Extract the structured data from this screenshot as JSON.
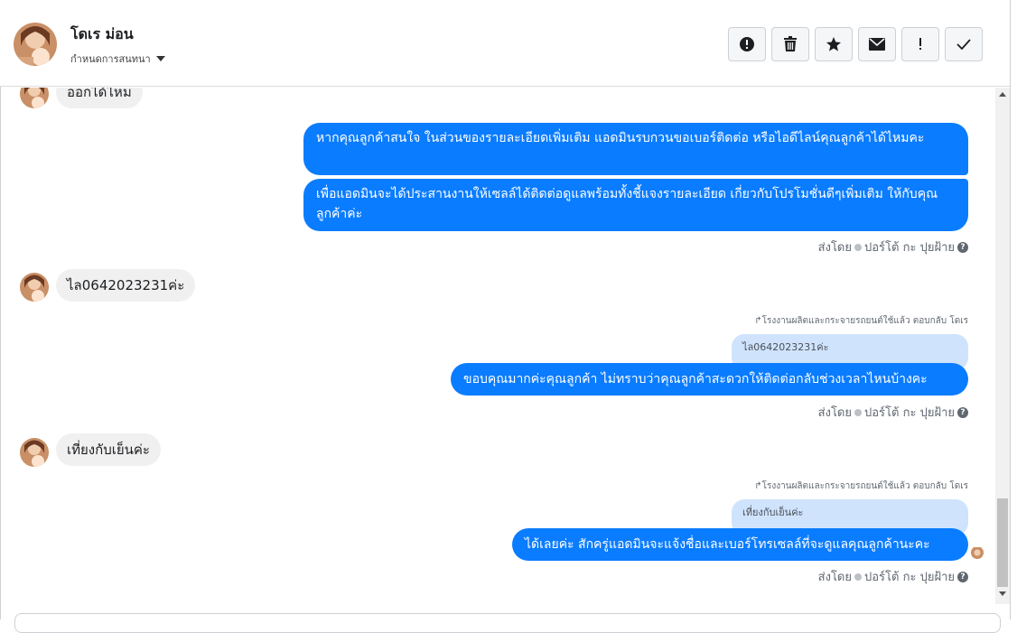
{
  "header": {
    "contact_name": "โดเร ม่อน",
    "assign_label": "กำหนดการสนทนา"
  },
  "toolbar": [
    {
      "name": "alert-icon",
      "label": "Mark as spam"
    },
    {
      "name": "trash-icon",
      "label": "Delete"
    },
    {
      "name": "star-icon",
      "label": "Star"
    },
    {
      "name": "mail-icon",
      "label": "Mark unread"
    },
    {
      "name": "exclamation-icon",
      "label": "Follow up"
    },
    {
      "name": "check-icon",
      "label": "Done"
    }
  ],
  "messages": {
    "m1_in": "ออกได้ไหม",
    "m2_out": "หากคุณลูกค้าสนใจ ในส่วนของรายละเอียดเพิ่มเติม แอดมินรบกวนขอเบอร์ติดต่อ หรือไอดีไลน์คุณลูกค้าได้ไหมคะ",
    "m3_out": "เพื่อแอดมินจะได้ประสานงานให้เซลล์ได้ติดต่อดูแลพร้อมทั้งชี้แจงรายละเอียด เกี่ยวกับโปรโมชั่นดีๆเพิ่มเติม ให้กับคุณลูกค้าค่ะ",
    "m4_in": "ไล0642023231ค่ะ",
    "m5_out": "ขอบคุณมากค่ะคุณลูกค้า ไม่ทราบว่าคุณลูกค้าสะดวกให้ติดต่อกลับช่วงเวลาไหนบ้างคะ",
    "m6_in": "เที่ยงกับเย็นค่ะ",
    "m7_out": "ได้เลยค่ะ สักครู่แอดมินจะแจ้งชื่อและเบอร์โทรเซลล์ที่จะดูแลคุณลูกค้านะคะ"
  },
  "meta": {
    "sent_by_prefix": "ส่งโดย",
    "sent_by_name": "ปอร์โต้ กะ ปุยฝ้าย",
    "help": "?"
  },
  "replies": {
    "note_1": "โรงงานผลิตและกระจายรถยนต์ใช้แล้ว ตอบกลับ โดเร",
    "quote_1": "ไล0642023231ค่ะ",
    "note_2": "โรงงานผลิตและกระจายรถยนต์ใช้แล้ว ตอบกลับ โดเร",
    "quote_2": "เที่ยงกับเย็นค่ะ"
  }
}
